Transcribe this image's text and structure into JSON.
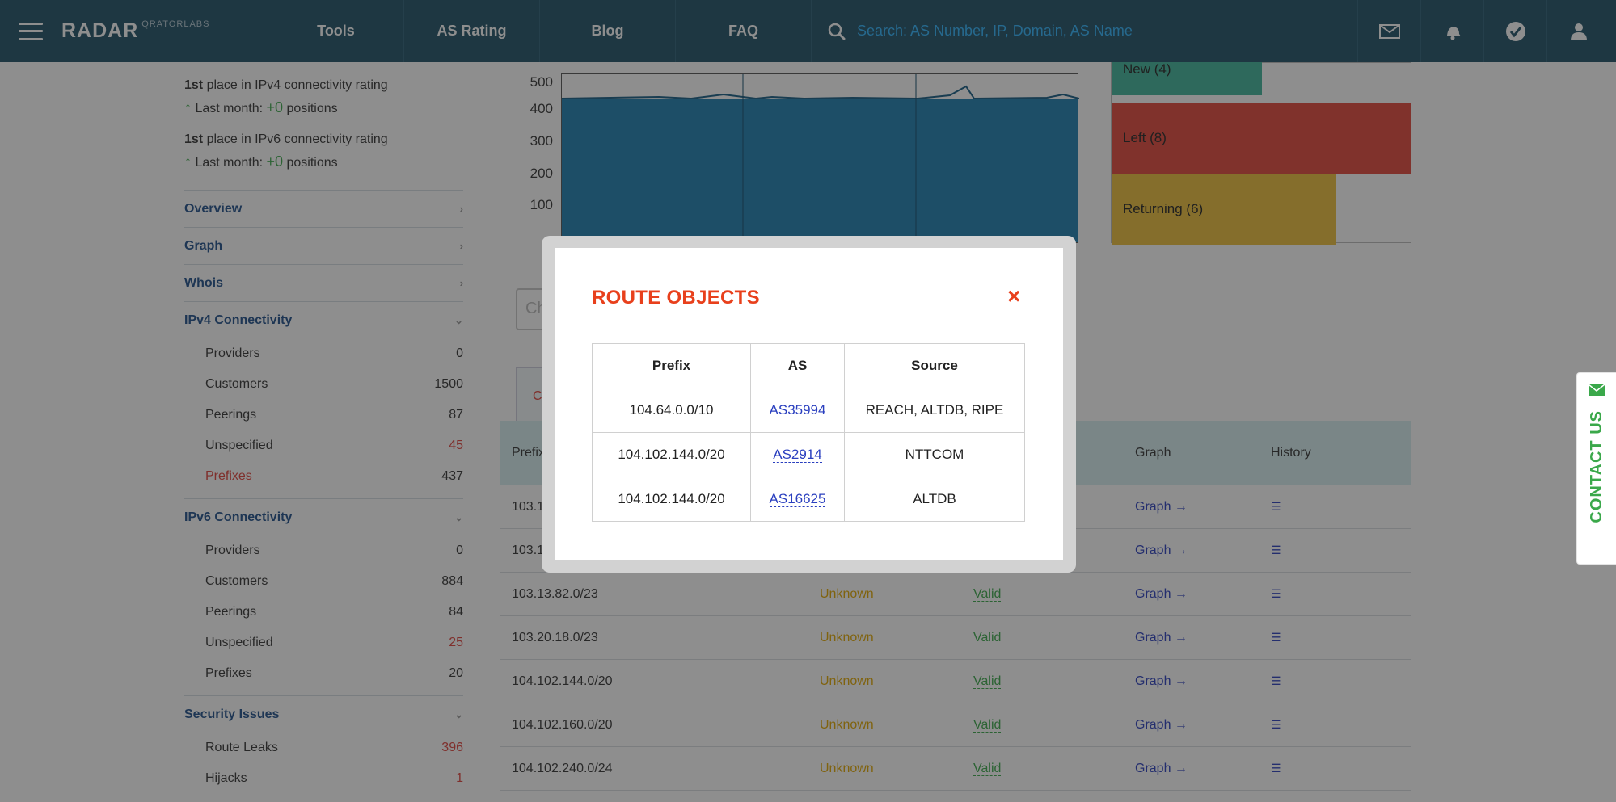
{
  "header": {
    "logo": "RADAR",
    "logo_sub": "QRATORLABS",
    "nav": [
      "Tools",
      "AS Rating",
      "Blog",
      "FAQ"
    ],
    "search_placeholder": "Search: AS Number, IP, Domain, AS Name"
  },
  "sidebar": {
    "ipv4_rating": {
      "place": "1st",
      "text": " place in IPv4 connectivity rating",
      "month_label": "Last month: ",
      "month_value": "+0",
      "month_suffix": " positions"
    },
    "ipv6_rating": {
      "place": "1st",
      "text": " place in IPv6 connectivity rating",
      "month_label": "Last month: ",
      "month_value": "+0",
      "month_suffix": " positions"
    },
    "sections": {
      "overview": "Overview",
      "graph": "Graph",
      "whois": "Whois",
      "ipv4": "IPv4 Connectivity",
      "ipv6": "IPv6 Connectivity",
      "security": "Security Issues"
    },
    "ipv4_items": [
      {
        "label": "Providers",
        "value": "0"
      },
      {
        "label": "Customers",
        "value": "1500"
      },
      {
        "label": "Peerings",
        "value": "87"
      },
      {
        "label": "Unspecified",
        "value": "45"
      },
      {
        "label": "Prefixes",
        "value": "437"
      }
    ],
    "ipv6_items": [
      {
        "label": "Providers",
        "value": "0"
      },
      {
        "label": "Customers",
        "value": "884"
      },
      {
        "label": "Peerings",
        "value": "84"
      },
      {
        "label": "Unspecified",
        "value": "25"
      },
      {
        "label": "Prefixes",
        "value": "20"
      }
    ],
    "security_items": [
      {
        "label": "Route Leaks",
        "value": "396"
      },
      {
        "label": "Hijacks",
        "value": "1"
      }
    ]
  },
  "chart": {
    "yticks": [
      "500",
      "400",
      "300",
      "200",
      "100"
    ]
  },
  "status_bars": {
    "new": "New (4)",
    "left": "Left (8)",
    "returning": "Returning (6)"
  },
  "background_table": {
    "headers": {
      "prefix": "Prefix",
      "graph": "Graph",
      "history": "History"
    },
    "rows": [
      {
        "prefix": "103.13.82.0/23",
        "visibility": "Unknown",
        "validity": "Valid"
      },
      {
        "prefix": "103.20.18.0/23",
        "visibility": "Unknown",
        "validity": "Valid"
      },
      {
        "prefix": "104.102.144.0/20",
        "visibility": "Unknown",
        "validity": "Valid"
      },
      {
        "prefix": "104.102.160.0/20",
        "visibility": "Unknown",
        "validity": "Valid"
      },
      {
        "prefix": "104.102.240.0/24",
        "visibility": "Unknown",
        "validity": "Valid"
      }
    ],
    "partial_rows": [
      "103.1",
      "103.1"
    ],
    "graph_link": "Graph →"
  },
  "modal": {
    "title": "ROUTE OBJECTS",
    "close": "×",
    "headers": [
      "Prefix",
      "AS",
      "Source"
    ],
    "rows": [
      {
        "prefix": "104.64.0.0/10",
        "as": "AS35994",
        "source": "REACH, ALTDB, RIPE"
      },
      {
        "prefix": "104.102.144.0/20",
        "as": "AS2914",
        "source": "NTTCOM"
      },
      {
        "prefix": "104.102.144.0/20",
        "as": "AS16625",
        "source": "ALTDB"
      }
    ]
  },
  "contact": {
    "label": "CONTACT US"
  },
  "colors": {
    "header": "#1e5066",
    "accent": "#e8401c",
    "green": "#3aa84a",
    "link": "#2a3fbf"
  }
}
